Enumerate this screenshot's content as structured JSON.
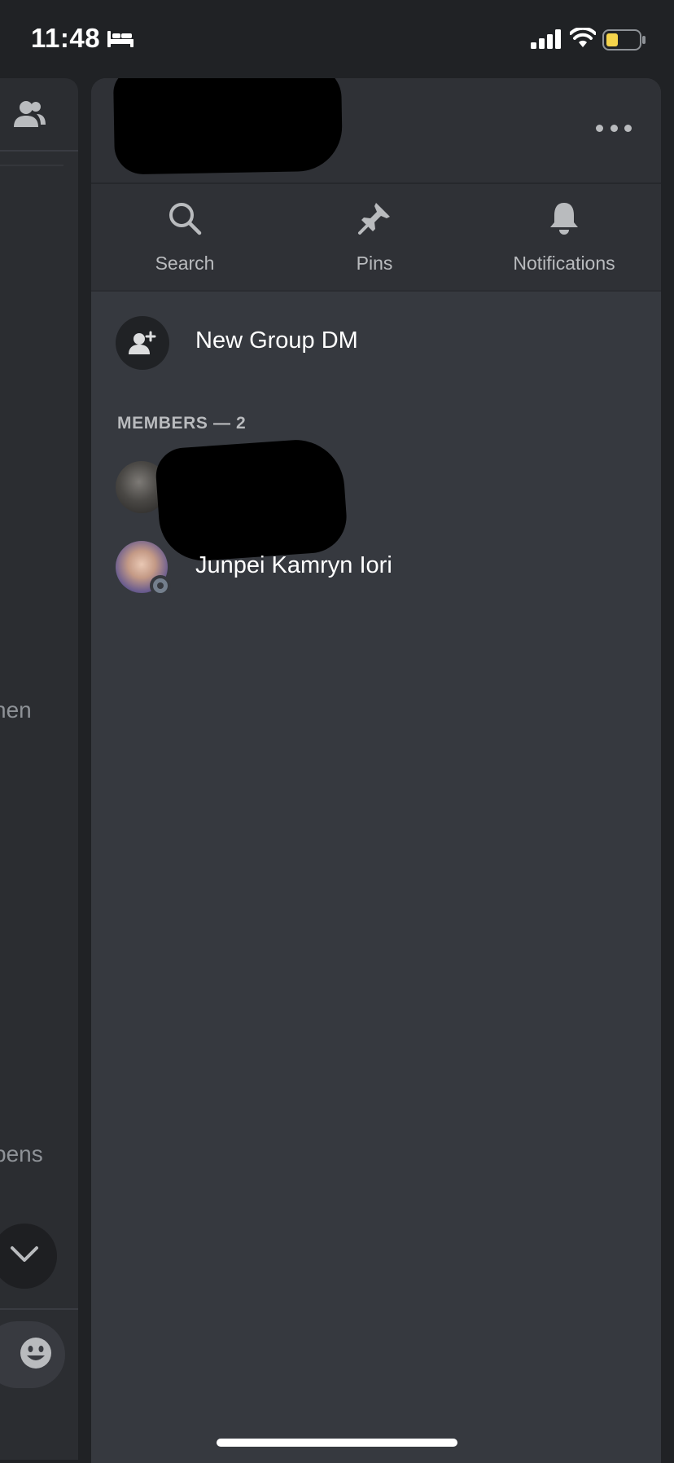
{
  "status_bar": {
    "time": "11:48",
    "bed_icon": "bed-icon",
    "signal_icon": "cellular-signal-icon",
    "wifi_icon": "wifi-icon",
    "battery_icon": "battery-icon",
    "battery_color": "#f5d44c"
  },
  "left_panel": {
    "friends_icon": "friends-icon",
    "snippet_1": "hen",
    "snippet_2": "pens",
    "scroll_icon": "chevron-down-icon",
    "emoji_icon": "emoji-icon"
  },
  "drawer": {
    "header": {
      "more_icon": "more-options-icon"
    },
    "toolbar": [
      {
        "label": "Search",
        "icon": "search-icon"
      },
      {
        "label": "Pins",
        "icon": "pin-icon"
      },
      {
        "label": "Notifications",
        "icon": "bell-icon"
      }
    ],
    "new_group": {
      "label": "New Group DM",
      "icon": "add-user-icon"
    },
    "members_header": "MEMBERS — 2",
    "members": [
      {
        "name": "",
        "status": "redacted"
      },
      {
        "name": "Junpei Kamryn Iori",
        "status": "offline"
      }
    ]
  },
  "colors": {
    "background": "#202225",
    "drawer": "#36393f",
    "header": "#2f3136",
    "muted_text": "#b9bbbe",
    "offline": "#747f8d"
  }
}
